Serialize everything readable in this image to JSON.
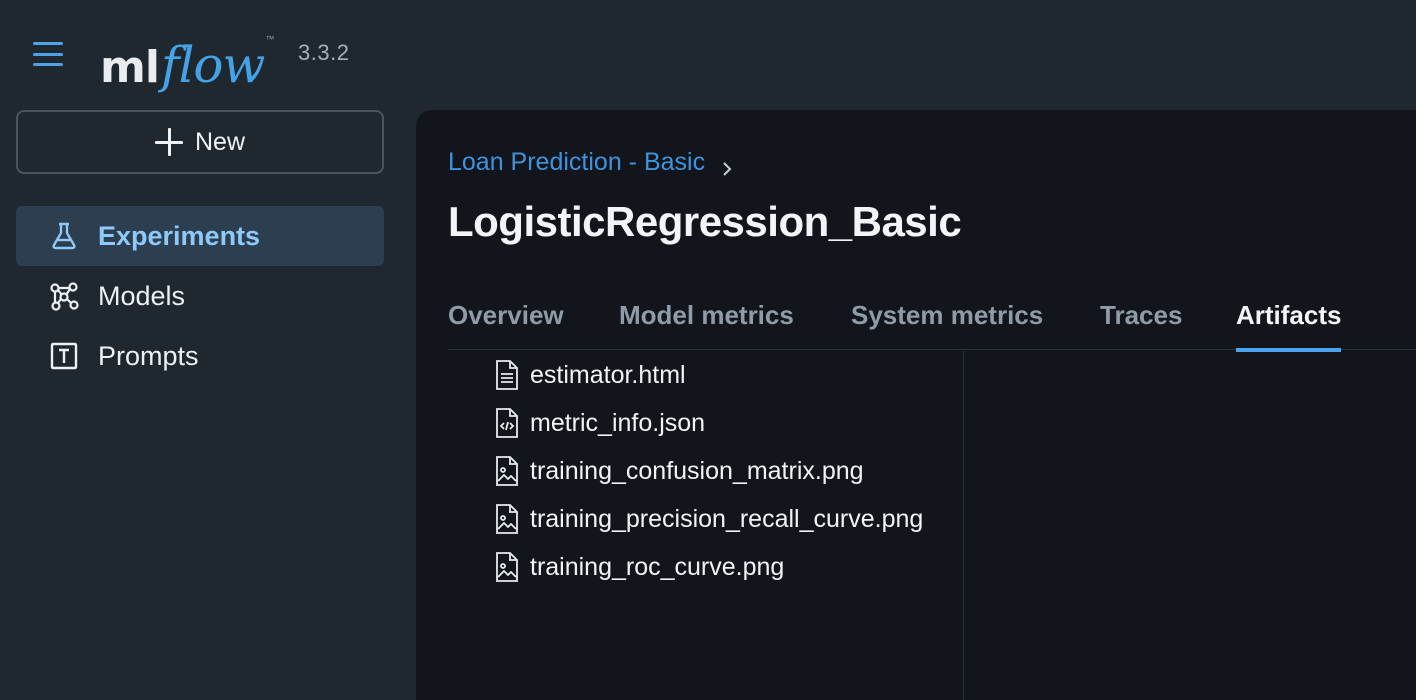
{
  "header": {
    "logo_ml": "ml",
    "logo_flow": "flow",
    "logo_tm": "™",
    "version": "3.3.2"
  },
  "sidebar": {
    "new_label": "New",
    "items": [
      {
        "label": "Experiments",
        "icon": "flask-icon",
        "active": true
      },
      {
        "label": "Models",
        "icon": "nodes-icon",
        "active": false
      },
      {
        "label": "Prompts",
        "icon": "text-box-icon",
        "active": false
      }
    ]
  },
  "main": {
    "breadcrumb": "Loan Prediction - Basic",
    "title": "LogisticRegression_Basic",
    "tabs": [
      {
        "label": "Overview",
        "active": false
      },
      {
        "label": "Model metrics",
        "active": false
      },
      {
        "label": "System metrics",
        "active": false
      },
      {
        "label": "Traces",
        "active": false
      },
      {
        "label": "Artifacts",
        "active": true
      }
    ],
    "files": [
      {
        "name": "estimator.html",
        "icon": "document-icon"
      },
      {
        "name": "metric_info.json",
        "icon": "code-file-icon"
      },
      {
        "name": "training_confusion_matrix.png",
        "icon": "image-file-icon"
      },
      {
        "name": "training_precision_recall_curve.png",
        "icon": "image-file-icon"
      },
      {
        "name": "training_roc_curve.png",
        "icon": "image-file-icon"
      }
    ]
  },
  "colors": {
    "accent": "#4aa3ec",
    "link": "#3d93dd",
    "sidebar_active_bg": "#2c3e4f",
    "background": "#1f272f",
    "panel": "#12161c"
  }
}
